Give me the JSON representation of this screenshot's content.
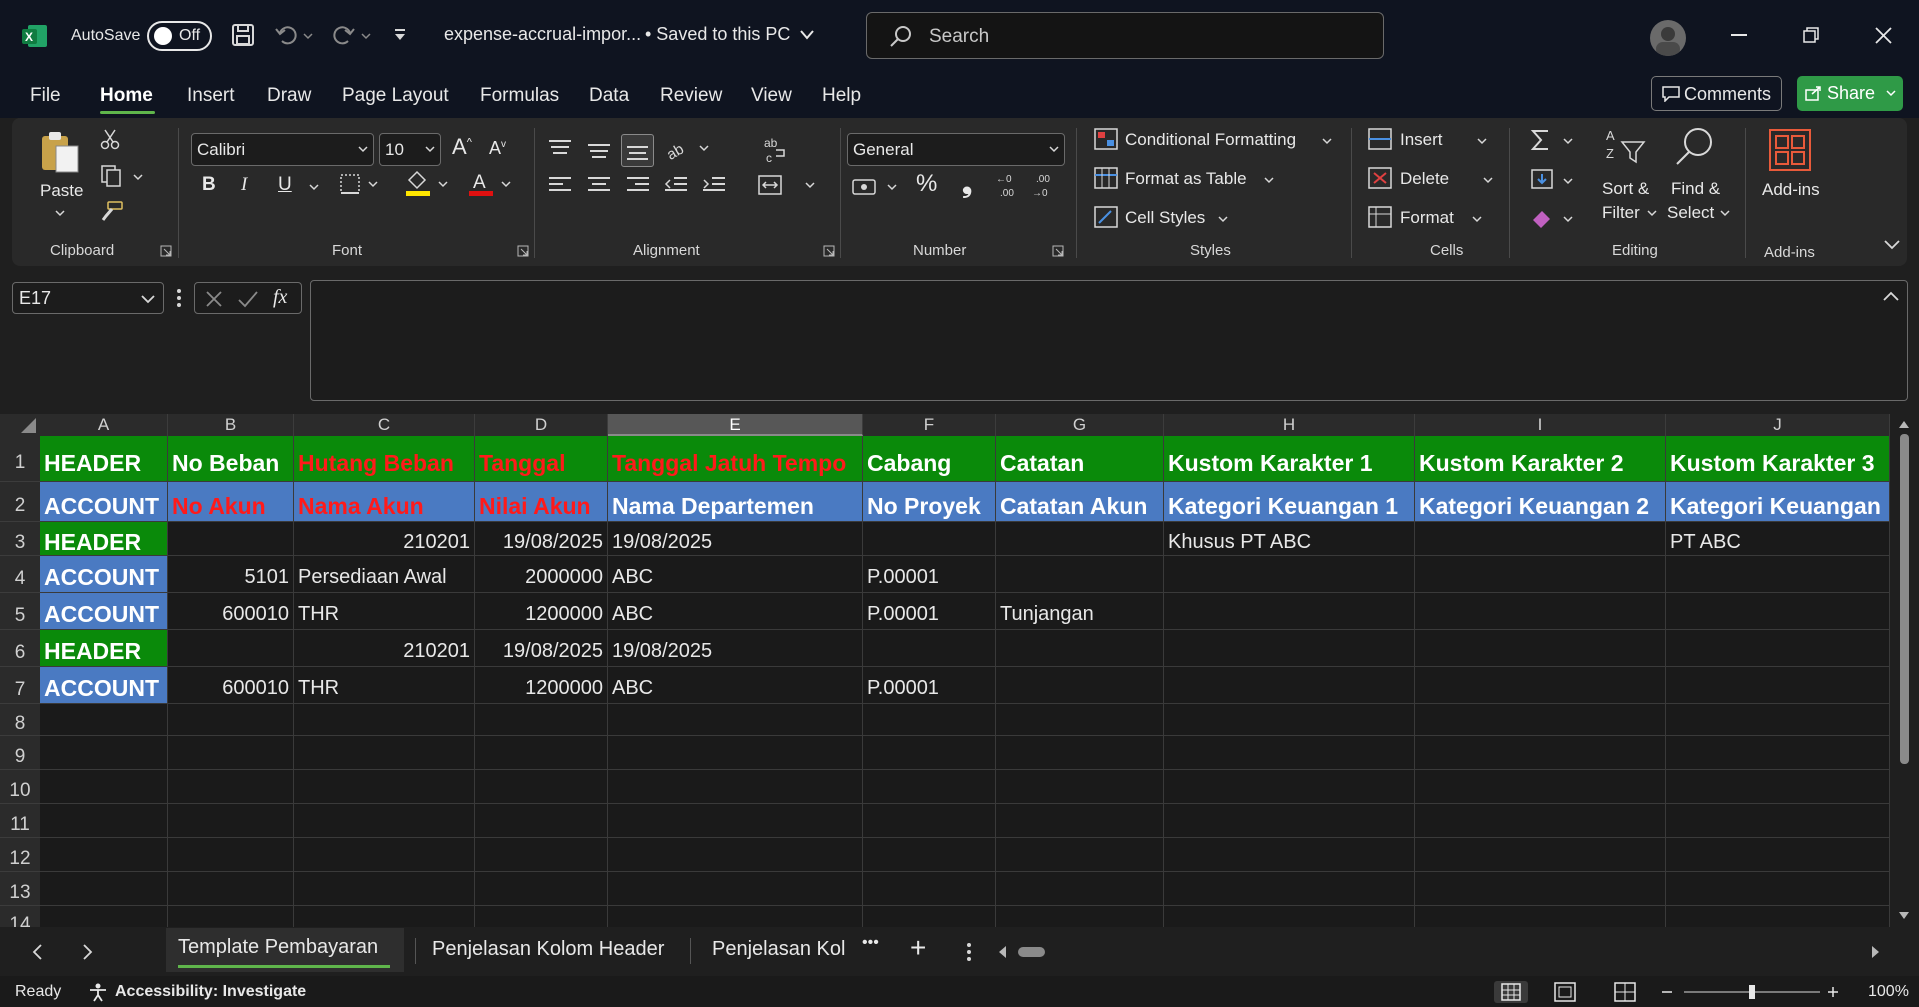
{
  "titlebar": {
    "autosave_label": "AutoSave",
    "autosave_state": "Off",
    "filename": "expense-accrual-impor...",
    "save_status": "• Saved to this PC",
    "search_placeholder": "Search"
  },
  "menu": {
    "tabs": [
      "File",
      "Home",
      "Insert",
      "Draw",
      "Page Layout",
      "Formulas",
      "Data",
      "Review",
      "View",
      "Help"
    ],
    "active": "Home",
    "comments_label": "Comments",
    "share_label": "Share"
  },
  "ribbon": {
    "clipboard": {
      "paste": "Paste",
      "label": "Clipboard"
    },
    "font": {
      "name": "Calibri",
      "size": "10",
      "label": "Font",
      "bold": "B",
      "italic": "I",
      "underline": "U"
    },
    "alignment": {
      "label": "Alignment"
    },
    "number": {
      "format": "General",
      "label": "Number",
      "percent": "%",
      "comma": "❟"
    },
    "styles": {
      "conditional": "Conditional Formatting",
      "table": "Format as Table",
      "cell": "Cell Styles",
      "label": "Styles"
    },
    "cells": {
      "insert": "Insert",
      "delete": "Delete",
      "format": "Format",
      "label": "Cells"
    },
    "editing": {
      "sort1": "Sort &",
      "sort2": "Filter",
      "find1": "Find &",
      "find2": "Select",
      "label": "Editing"
    },
    "addins": {
      "button": "Add-ins",
      "label": "Add-ins"
    }
  },
  "formula_bar": {
    "name_box": "E17",
    "fx": "fx",
    "formula": ""
  },
  "grid": {
    "columns": [
      "A",
      "B",
      "C",
      "D",
      "E",
      "F",
      "G",
      "H",
      "I",
      "J"
    ],
    "selected_column": "E",
    "rows": [
      "1",
      "2",
      "3",
      "4",
      "5",
      "6",
      "7",
      "8",
      "9",
      "10",
      "11",
      "12",
      "13",
      "14"
    ],
    "r1": [
      "HEADER",
      "No Beban",
      "Hutang Beban",
      "Tanggal",
      "Tanggal Jatuh Tempo",
      "Cabang",
      "Catatan",
      "Kustom Karakter 1",
      "Kustom Karakter 2",
      "Kustom Karakter 3"
    ],
    "r2": [
      "ACCOUNT",
      "No Akun",
      "Nama Akun",
      "Nilai Akun",
      "Nama Departemen",
      "No Proyek",
      "Catatan Akun",
      "Kategori Keuangan 1",
      "Kategori Keuangan 2",
      "Kategori Keuangan"
    ],
    "r3": [
      "HEADER",
      "",
      "210201",
      "19/08/2025",
      "19/08/2025",
      "",
      "",
      "Khusus PT ABC",
      "",
      "PT ABC"
    ],
    "r4": [
      "ACCOUNT",
      "5101",
      "Persediaan Awal",
      "2000000",
      "ABC",
      "P.00001",
      "",
      "",
      "",
      ""
    ],
    "r5": [
      "ACCOUNT",
      "600010",
      "THR",
      "1200000",
      "ABC",
      "P.00001",
      "Tunjangan",
      "",
      "",
      ""
    ],
    "r6": [
      "HEADER",
      "",
      "210201",
      "19/08/2025",
      "19/08/2025",
      "",
      "",
      "",
      "",
      ""
    ],
    "r7": [
      "ACCOUNT",
      "600010",
      "THR",
      "1200000",
      "ABC",
      "P.00001",
      "",
      "",
      "",
      ""
    ]
  },
  "sheets": {
    "tabs": [
      "Template Pembayaran",
      "Penjelasan Kolom Header",
      "Penjelasan Kol"
    ],
    "more": "•••",
    "add": "+"
  },
  "status": {
    "ready": "Ready",
    "accessibility": "Accessibility: Investigate",
    "zoom": "100%"
  }
}
